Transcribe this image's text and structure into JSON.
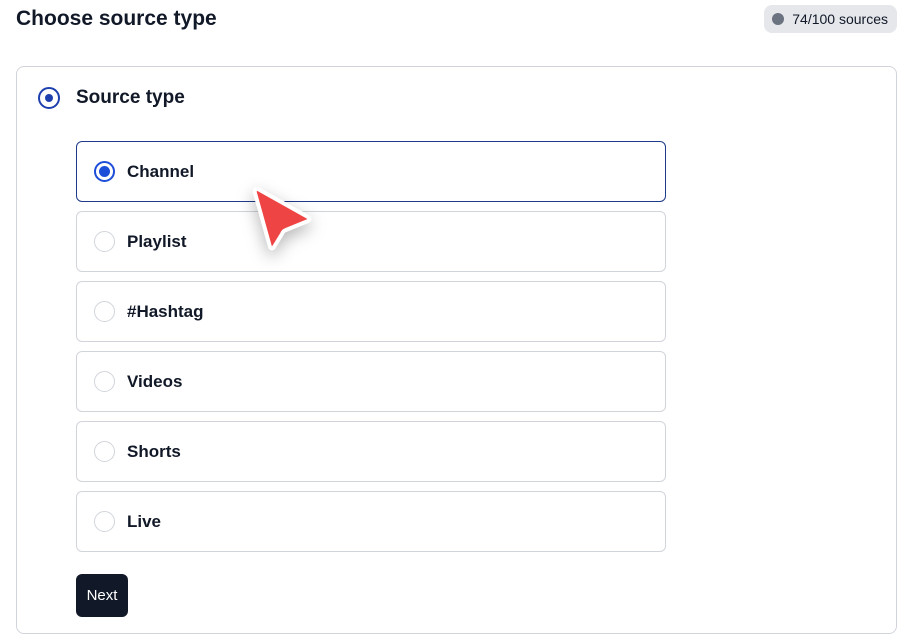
{
  "header": {
    "title": "Choose source type",
    "quota_label": "74/100 sources"
  },
  "section": {
    "title": "Source type"
  },
  "options": [
    {
      "label": "Channel",
      "selected": true
    },
    {
      "label": "Playlist",
      "selected": false
    },
    {
      "label": "#Hashtag",
      "selected": false
    },
    {
      "label": "Videos",
      "selected": false
    },
    {
      "label": "Shorts",
      "selected": false
    },
    {
      "label": "Live",
      "selected": false
    }
  ],
  "actions": {
    "next_label": "Next"
  },
  "colors": {
    "accent": "#1d4ed8",
    "button_bg": "#111827",
    "cursor": "#ef4444"
  },
  "icons": {
    "cursor": "pointer-arrow-icon"
  }
}
